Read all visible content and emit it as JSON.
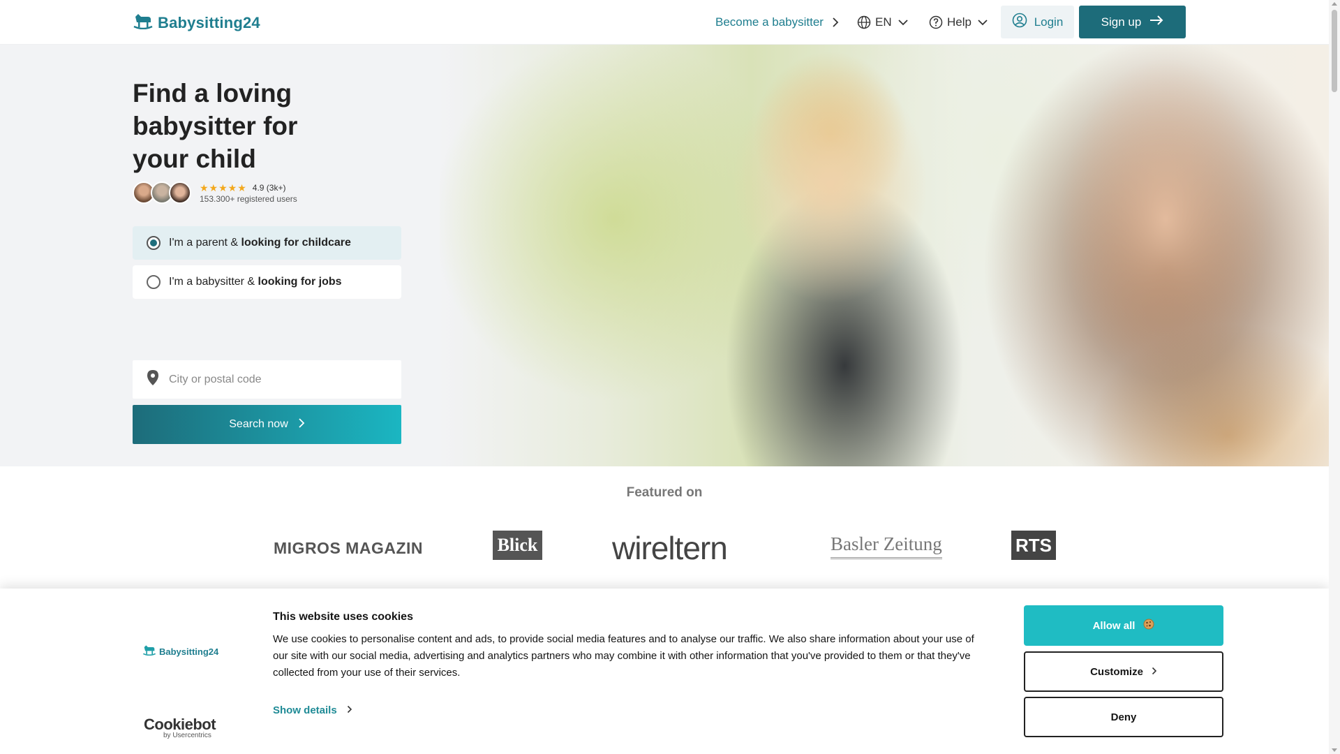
{
  "header": {
    "logo_text": "Babysitting24",
    "become_babysitter": "Become a babysitter",
    "language": "EN",
    "help": "Help",
    "login": "Login",
    "signup": "Sign up",
    "brand_color": "#1f7e8f",
    "signup_color": "#1d6c7a"
  },
  "hero": {
    "title": "Find a loving babysitter for your child",
    "rating": "4.9 (3k+)",
    "registered_users": "153.300+ registered users",
    "stars": "★★★★★",
    "options": [
      {
        "prefix": "I'm a parent & ",
        "bold": "looking for childcare",
        "selected": true
      },
      {
        "prefix": "I'm a babysitter & ",
        "bold": "looking for jobs",
        "selected": false
      }
    ],
    "location_placeholder": "City or postal code",
    "search_button": "Search now"
  },
  "featured": {
    "title": "Featured on",
    "logos": [
      "MIGROS MAGAZIN",
      "Blick",
      "wireltern",
      "Basler Zeitung",
      "RTS"
    ]
  },
  "cookie_banner": {
    "logo_text": "Babysitting24",
    "cookiebot": "Cookiebot",
    "cookiebot_sub": "by Usercentrics",
    "title": "This website uses cookies",
    "text": "We use cookies to personalise content and ads, to provide social media features and to analyse our traffic. We also share information about your use of our site with our social media, advertising and analytics partners who may combine it with other information that you've provided to them or that they've collected from your use of their services.",
    "show_details": "Show details",
    "allow_all": "Allow all",
    "customize": "Customize",
    "deny": "Deny",
    "allow_color": "#1fbcc3"
  }
}
